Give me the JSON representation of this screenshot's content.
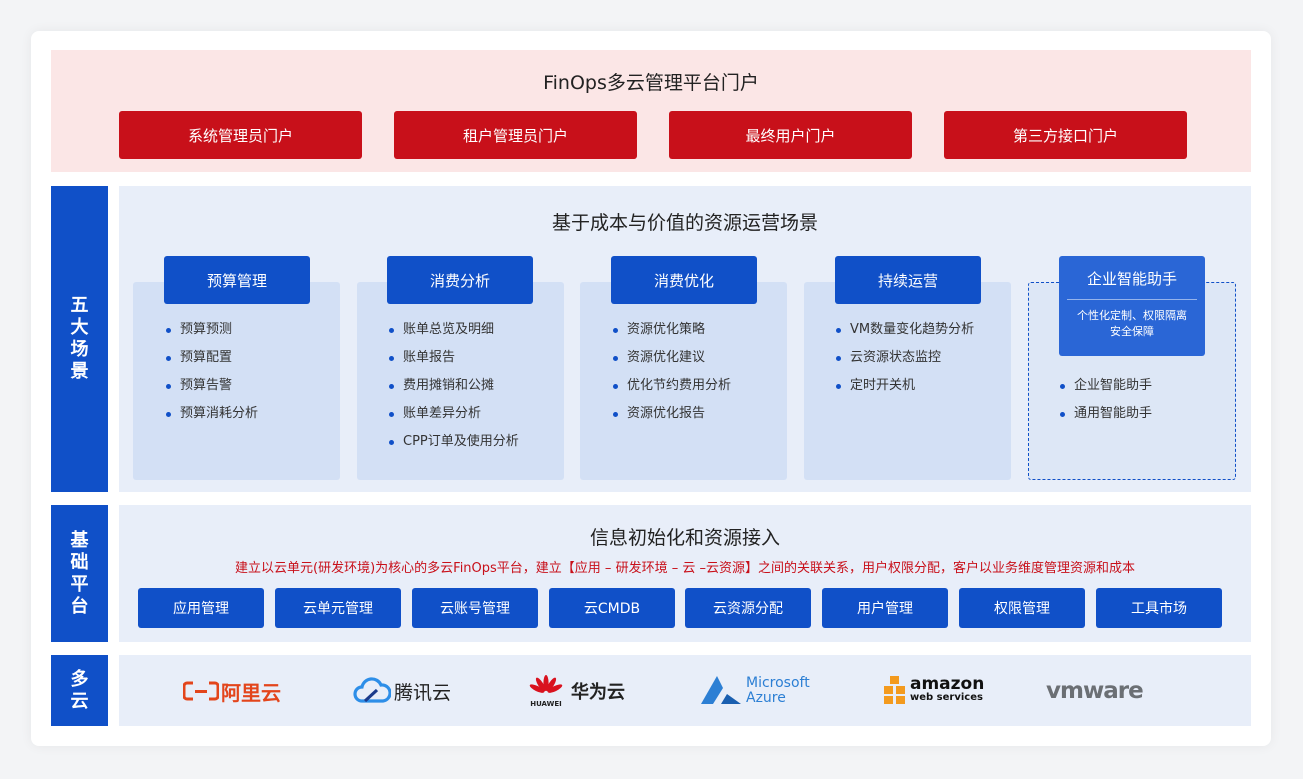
{
  "portal": {
    "title": "FinOps多云管理平台门户",
    "buttons": [
      "系统管理员门户",
      "租户管理员门户",
      "最终用户门户",
      "第三方接口门户"
    ]
  },
  "side_labels": {
    "scenarios": "五大场景",
    "base": "基础平台",
    "cloud": "多云"
  },
  "scenarios": {
    "title": "基于成本与价值的资源运营场景",
    "columns": [
      {
        "title": "预算管理",
        "items": [
          "预算预测",
          "预算配置",
          "预算告警",
          "预算消耗分析"
        ]
      },
      {
        "title": "消费分析",
        "items": [
          "账单总览及明细",
          "账单报告",
          "费用摊销和公摊",
          "账单差异分析",
          "CPP订单及使用分析"
        ]
      },
      {
        "title": "消费优化",
        "items": [
          "资源优化策略",
          "资源优化建议",
          "优化节约费用分析",
          "资源优化报告"
        ]
      },
      {
        "title": "持续运营",
        "items": [
          "VM数量变化趋势分析",
          "云资源状态监控",
          "定时开关机"
        ]
      }
    ],
    "ai": {
      "title": "企业智能助手",
      "desc_line1": "个性化定制、权限隔离",
      "desc_line2": "安全保障",
      "items": [
        "企业智能助手",
        "通用智能助手"
      ]
    }
  },
  "base": {
    "title": "信息初始化和资源接入",
    "desc": "建立以云单元(研发环境)为核心的多云FinOps平台，建立【应用 – 研发环境 – 云 –云资源】之间的关联关系，用户权限分配，客户以业务维度管理资源和成本",
    "buttons": [
      "应用管理",
      "云单元管理",
      "云账号管理",
      "云CMDB",
      "云资源分配",
      "用户管理",
      "权限管理",
      "工具市场"
    ]
  },
  "clouds": {
    "aliyun": "阿里云",
    "tencent": "腾讯云",
    "huawei_brand": "HUAWEI",
    "huawei": "华为云",
    "azure_line1": "Microsoft",
    "azure_line2": "Azure",
    "aws_line1": "amazon",
    "aws_line2": "web services",
    "vmware": "vmware"
  },
  "colors": {
    "brand_red": "#c8101a",
    "brand_blue": "#1050c8",
    "aliyun_orange": "#e3451c",
    "tencent_blue": "#2d8ee8",
    "azure_blue": "#2c7fd4",
    "aws_orange": "#f39a1e"
  }
}
